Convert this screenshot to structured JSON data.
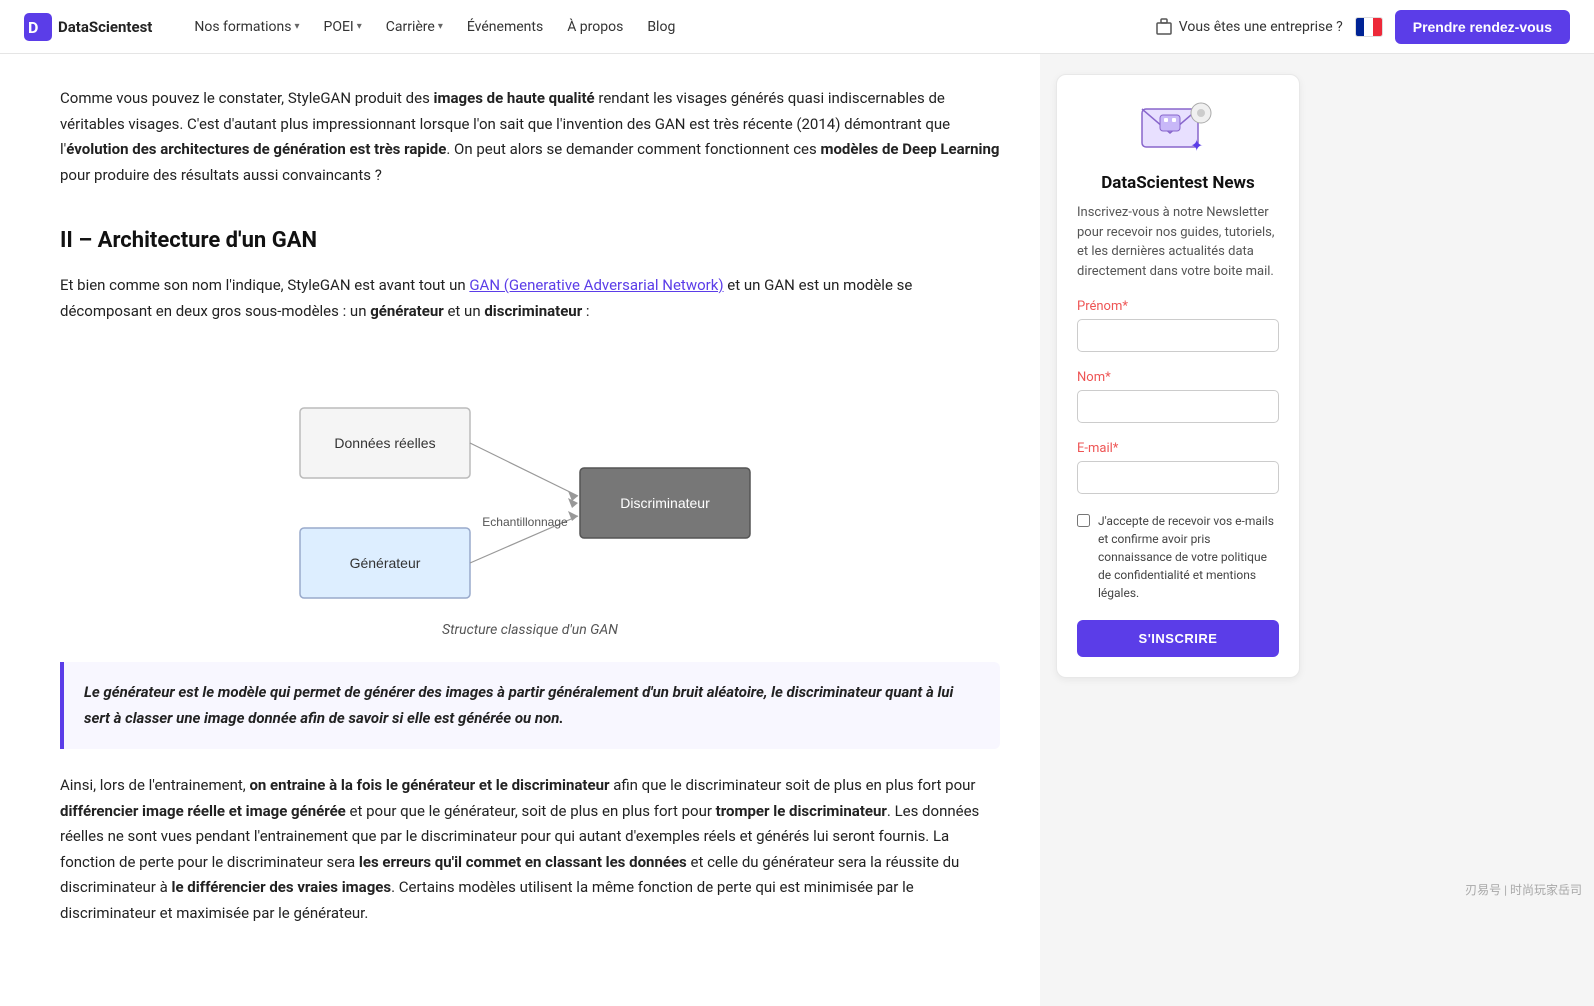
{
  "nav": {
    "logo_text": "DataScientest",
    "links": [
      {
        "label": "Nos formations",
        "has_dropdown": true
      },
      {
        "label": "POEI",
        "has_dropdown": true
      },
      {
        "label": "Carrière",
        "has_dropdown": true
      },
      {
        "label": "Événements",
        "has_dropdown": false
      },
      {
        "label": "À propos",
        "has_dropdown": false
      },
      {
        "label": "Blog",
        "has_dropdown": false
      }
    ],
    "enterprise_label": "Vous êtes une entreprise ?",
    "cta_label": "Prendre rendez-vous"
  },
  "article": {
    "intro_text_1": "Comme vous pouvez le constater, StyleGAN produit des ",
    "intro_bold_1": "images de haute qualité",
    "intro_text_2": " rendant les visages générés quasi indiscernables de véritables visages. C'est d'autant plus impressionnant lorsque l'on sait que l'invention des GAN est très récente (2014) démontrant que l'",
    "intro_bold_2": "évolution des architectures de génération est très rapide",
    "intro_text_3": ". On peut alors se demander comment fonctionnent ces ",
    "intro_bold_3": "modèles de Deep Learning",
    "intro_text_4": " pour produire des résultats aussi convaincants ?",
    "section_title": "II – Architecture d'un GAN",
    "para1_text_1": "Et bien comme son nom l'indique, StyleGAN est avant tout un ",
    "para1_link": "GAN (Generative Adversarial Network)",
    "para1_text_2": " et un GAN est un modèle se décomposant en deux gros sous-modèles : un ",
    "para1_bold_1": "générateur",
    "para1_text_3": " et un ",
    "para1_bold_2": "discriminateur",
    "para1_text_4": " :",
    "diagram_caption": "Structure classique d'un GAN",
    "diagram_node_real": "Données réelles",
    "diagram_node_gen": "Générateur",
    "diagram_node_sample": "Echantillonnage",
    "diagram_node_disc": "Discriminateur",
    "blockquote": "Le générateur est le modèle qui permet de générer des images à partir généralement d'un bruit aléatoire, le discriminateur quant à lui sert à classer une image donnée afin de savoir si elle est générée ou non.",
    "para2_text_1": "Ainsi, lors de l'entrainement, ",
    "para2_bold_1": "on entraine à la fois le générateur et le discriminateur",
    "para2_text_2": " afin que le discriminateur soit de plus en plus fort pour ",
    "para2_bold_2": "différencier image réelle et image générée",
    "para2_text_3": " et pour que le générateur, soit de plus en plus fort pour ",
    "para2_bold_3": "tromper le discriminateur",
    "para2_text_4": ". Les données réelles ne sont vues pendant l'entrainement que par le discriminateur pour qui autant d'exemples réels et générés lui seront fournis. La fonction de perte pour le discriminateur sera ",
    "para2_bold_4": "les erreurs qu'il commet en classant les données",
    "para2_text_5": " et celle du générateur sera la réussite du discriminateur à ",
    "para2_bold_5": "le différencier des vraies images",
    "para2_text_6": ". Certains modèles utilisent la même fonction de perte qui est minimisée par le discriminateur et maximisée par le générateur."
  },
  "sidebar": {
    "news_title": "DataScientest News",
    "news_subtitle": "Inscrivez-vous à notre Newsletter pour recevoir nos guides, tutoriels, et les dernières actualités data directement dans votre boite mail.",
    "label_prenom": "Prénom",
    "label_nom": "Nom",
    "label_email": "E-mail",
    "placeholder_prenom": "",
    "placeholder_nom": "",
    "placeholder_email": "",
    "checkbox_label": "J'accepte de recevoir vos e-mails et confirme avoir pris connaissance de votre politique de confidentialité et mentions légales.",
    "btn_subscribe": "S'INSCRIRE"
  },
  "watermark": "刃易号 | 时尚玩家岳司"
}
